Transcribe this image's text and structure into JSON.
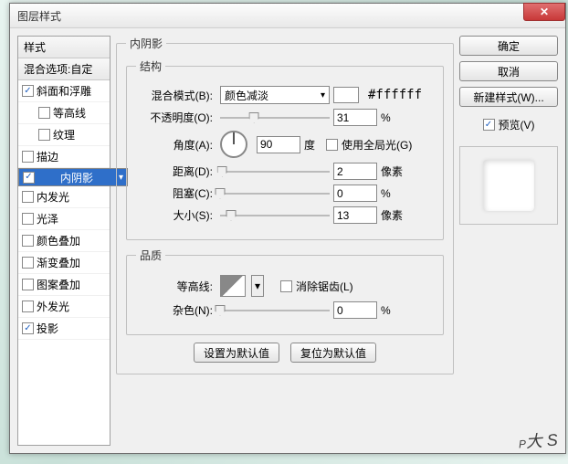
{
  "window": {
    "title": "图层样式"
  },
  "sidebar": {
    "header": "样式",
    "blend": "混合选项:自定",
    "items": [
      {
        "label": "斜面和浮雕",
        "checked": true
      },
      {
        "label": "等高线",
        "checked": false,
        "sub": true
      },
      {
        "label": "纹理",
        "checked": false,
        "sub": true
      },
      {
        "label": "描边",
        "checked": false
      },
      {
        "label": "内阴影",
        "checked": true,
        "selected": true
      },
      {
        "label": "内发光",
        "checked": false
      },
      {
        "label": "光泽",
        "checked": false
      },
      {
        "label": "颜色叠加",
        "checked": false
      },
      {
        "label": "渐变叠加",
        "checked": false
      },
      {
        "label": "图案叠加",
        "checked": false
      },
      {
        "label": "外发光",
        "checked": false
      },
      {
        "label": "投影",
        "checked": true
      }
    ]
  },
  "panel": {
    "title": "内阴影",
    "structure": {
      "legend": "结构",
      "blendmode": {
        "label": "混合模式(B):",
        "value": "颜色减淡",
        "hex": "#ffffff"
      },
      "opacity": {
        "label": "不透明度(O):",
        "value": "31",
        "unit": "%",
        "pos": 31
      },
      "angle": {
        "label": "角度(A):",
        "value": "90",
        "unit": "度",
        "global_label": "使用全局光(G)",
        "global": false
      },
      "distance": {
        "label": "距离(D):",
        "value": "2",
        "unit": "像素",
        "pos": 2
      },
      "choke": {
        "label": "阻塞(C):",
        "value": "0",
        "unit": "%",
        "pos": 0
      },
      "size": {
        "label": "大小(S):",
        "value": "13",
        "unit": "像素",
        "pos": 10
      }
    },
    "quality": {
      "legend": "品质",
      "contour": {
        "label": "等高线:",
        "aa_label": "消除锯齿(L)",
        "aa": false
      },
      "noise": {
        "label": "杂色(N):",
        "value": "0",
        "unit": "%",
        "pos": 0
      }
    },
    "defaults": {
      "set": "设置为默认值",
      "reset": "复位为默认值"
    }
  },
  "right": {
    "ok": "确定",
    "cancel": "取消",
    "newstyle": "新建样式(W)...",
    "preview_label": "预览(V)",
    "preview": true
  },
  "watermark": "P",
  "watermark_sub": "大 S"
}
